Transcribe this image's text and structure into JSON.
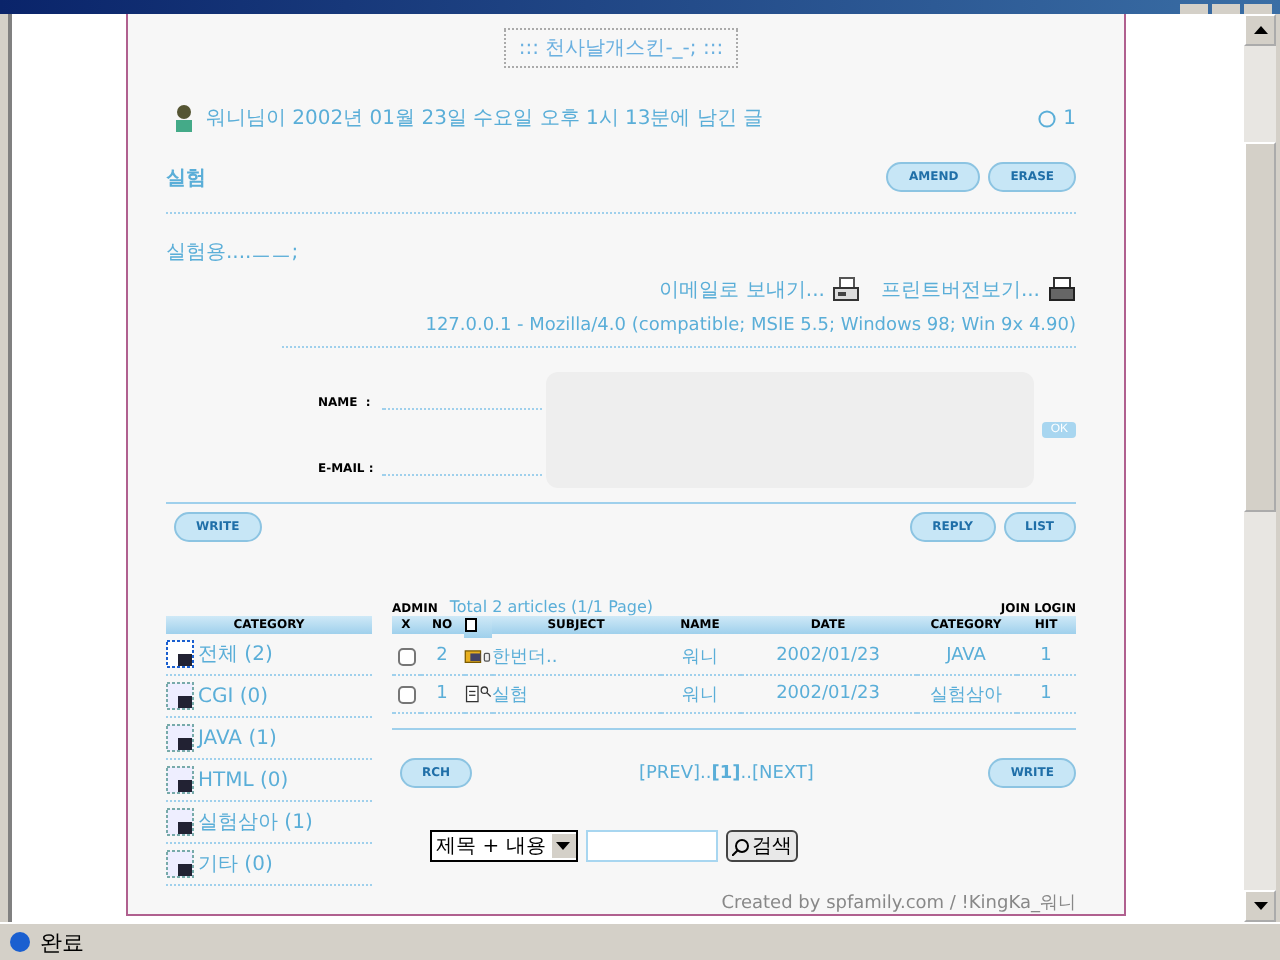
{
  "board_title": "::: 천사날개스킨-_-; :::",
  "post": {
    "author_line": "워니님이 2002년 01월 23일 수요일 오후 1시 13분에 남긴 글",
    "hits": "1",
    "subject": "실험",
    "buttons": [
      "AMEND",
      "ERASE"
    ],
    "body": "실험용....ㅡㅡ;",
    "actions": [
      {
        "label": "이메일로 보내기...",
        "kind": "email"
      },
      {
        "label": "프린트버전보기...",
        "kind": "print"
      }
    ],
    "agent": "127.0.0.1 - Mozilla/4.0 (compatible; MSIE 5.5; Windows 98; Win 9x 4.90)"
  },
  "comment_form": {
    "name_label": "NAME  :",
    "email_label": "E-MAIL :",
    "submit": "OK"
  },
  "nav_buttons": {
    "left": [
      "WRITE"
    ],
    "right": [
      "REPLY",
      "LIST"
    ]
  },
  "category": {
    "title": "CATEGORY",
    "items": [
      {
        "label": "전체 (2)",
        "selected": true
      },
      {
        "label": "CGI (0)",
        "selected": false
      },
      {
        "label": "JAVA (1)",
        "selected": false
      },
      {
        "label": "HTML (0)",
        "selected": false
      },
      {
        "label": "실험삼아 (1)",
        "selected": false
      },
      {
        "label": "기타 (0)",
        "selected": false
      }
    ]
  },
  "list": {
    "admin": "ADMIN",
    "total": "Total 2 articles (1/1 Page)",
    "join_login": "JOIN LOGIN",
    "columns": [
      {
        "kind": "text",
        "label": "X"
      },
      {
        "kind": "text",
        "label": "NO"
      },
      {
        "kind": "icon"
      },
      {
        "kind": "text",
        "label": "SUBJECT"
      },
      {
        "kind": "text",
        "label": "NAME"
      },
      {
        "kind": "text",
        "label": "DATE"
      },
      {
        "kind": "text",
        "label": "CATEGORY"
      },
      {
        "kind": "text",
        "label": "HIT"
      }
    ],
    "rows": [
      {
        "checked": false,
        "no": "2",
        "kind": "folder",
        "subject": "한번더..",
        "name": "워니",
        "date": "2002/01/23",
        "category": "JAVA",
        "hit": "1"
      },
      {
        "checked": false,
        "no": "1",
        "kind": "document",
        "subject": "실험",
        "name": "워니",
        "date": "2002/01/23",
        "category": "실험삼아",
        "hit": "1"
      }
    ]
  },
  "pager": {
    "left_button": "RCH",
    "pages": "[PREV]..**[1]**..[NEXT]",
    "right_button": "WRITE"
  },
  "search": {
    "field": "제목 + 내용",
    "button": "검색"
  },
  "credit": "Created by spfamily.com / !KingKa_워니",
  "status_bar": {
    "text": "완료"
  }
}
